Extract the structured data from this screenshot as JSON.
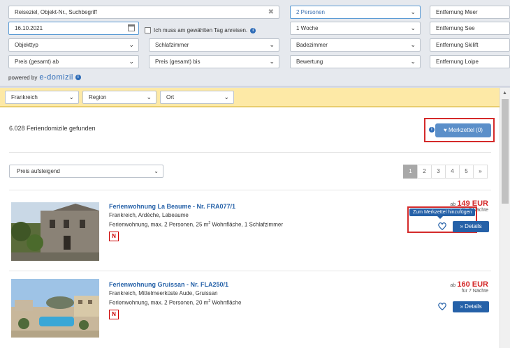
{
  "search": {
    "destination_placeholder": "Reiseziel, Objekt-Nr., Suchbegriff",
    "date": "16.10.2021",
    "checkbox_label": "Ich muss am gewählten Tag anreisen.",
    "persons": "2 Personen",
    "duration": "1 Woche",
    "property_type": "Objekttyp",
    "bedrooms": "Schlafzimmer",
    "bathrooms": "Badezimmer",
    "rating": "Bewertung",
    "price_from": "Preis (gesamt) ab",
    "price_to": "Preis (gesamt) bis",
    "dist_sea": "Entfernung Meer",
    "dist_lake": "Entfernung See",
    "dist_ski": "Entfernung Skilift",
    "dist_trail": "Entfernung Loipe",
    "powered_by": "powered by",
    "powered_logo": "e-domizil"
  },
  "filters": {
    "country": "Frankreich",
    "region": "Region",
    "place": "Ort"
  },
  "results": {
    "count_text": "6.028 Feriendomizile gefunden",
    "merkzettel_label": "Merkzettel (0)",
    "sort_label": "Preis aufsteigend",
    "pages": [
      "1",
      "2",
      "3",
      "4",
      "5",
      "»"
    ]
  },
  "listings": [
    {
      "title": "Ferienwohnung La Beaume - Nr. FRA077/1",
      "location": "Frankreich, Ardèche, Labeaume",
      "description_pre": "Ferienwohnung, max. 2 Personen, 25 m",
      "description_post": " Wohnfläche, 1 Schlafzimmer",
      "sup": "2",
      "price_prefix": "ab",
      "price": "149 EUR",
      "nights": "für 7 Nächte",
      "details_label": "» Details",
      "tooltip": "Zum Merkzettel hinzufügen",
      "badge": "N"
    },
    {
      "title": "Ferienwohnung Gruissan - Nr. FLA250/1",
      "location": "Frankreich, Mittelmeerküste Aude, Gruissan",
      "description_pre": "Ferienwohnung, max. 2 Personen, 20 m",
      "description_post": " Wohnfläche",
      "sup": "2",
      "price_prefix": "ab",
      "price": "160 EUR",
      "nights": "für 7 Nächte",
      "details_label": "» Details",
      "badge": "N"
    }
  ]
}
